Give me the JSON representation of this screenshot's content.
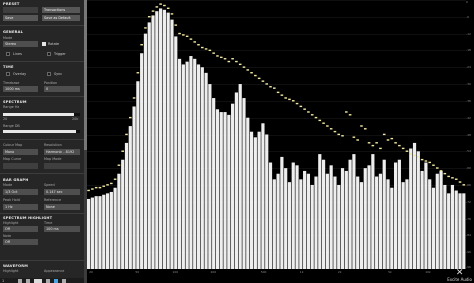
{
  "preset": {
    "header": "PRESET",
    "name": "",
    "transactions_button": "Transactions",
    "save_button": "Save",
    "save_default_button": "Save as Default"
  },
  "general": {
    "header": "GENERAL",
    "mode_label": "Mode",
    "mode_value": "Stereo",
    "rotate_label": "Rotate",
    "lines_label": "Lines",
    "trigger_label": "Trigger"
  },
  "time": {
    "header": "TIME",
    "overlay_label": "Overlay",
    "sync_label": "Sync",
    "timebase_label": "Timebase",
    "timebase_value": "1000 ms",
    "position_label": "Position",
    "position_value": "0"
  },
  "spectrum": {
    "header": "SPECTRUM",
    "range_hz_label": "Range Hz",
    "range_hz_left": "20",
    "range_hz_right": "20k",
    "range_db_label": "Range DB",
    "range_hz_fill": 0.92,
    "range_db_fill": 0.95
  },
  "colour": {
    "colour_map_label": "Colour Map",
    "colour_map_value": "Mono",
    "resolution_label": "Resolution",
    "resolution_value": "Harmonic - 8192",
    "map_curve_label": "Map Curve",
    "map_mode_label": "Map Mode"
  },
  "bar_graph": {
    "header": "BAR GRAPH",
    "mode_label": "Mode",
    "mode_value": "1/3 Oct",
    "speed_label": "Speed",
    "speed_value": "0.147 sec",
    "peak_hold_label": "Peak Hold",
    "peak_hold_value": "1 Hz",
    "reference_label": "Reference",
    "reference_value": "None"
  },
  "spectrum_highlight": {
    "header": "SPECTRUM HIGHLIGHT",
    "highlight_label": "Highlight",
    "highlight_value": "Off",
    "time_label": "Time",
    "time_value": "100 ms",
    "note_label": "Note",
    "note_value": "Off"
  },
  "waveform": {
    "header": "WAVEFORM",
    "highlight_label": "Highlight",
    "appearance_label": "Appearance"
  },
  "toolbar": {
    "page_value": "1"
  },
  "brand": {
    "mark": "✕",
    "name": "Excite Audio"
  },
  "y_axis_labels": [
    "0",
    "-6",
    "-12",
    "-18",
    "-24",
    "-30",
    "-36",
    "-42",
    "-48",
    "-54",
    "-60",
    "-66",
    "-72",
    "-78",
    "-84",
    "-90",
    "-96"
  ],
  "x_axis_labels": [
    "20",
    "50",
    "100",
    "200",
    "500",
    "1k",
    "2k",
    "5k",
    "10k"
  ],
  "colors": {
    "bar": "#eeeeee",
    "peak": "#f0e6a0",
    "background": "#000000",
    "panel": "#262626"
  },
  "chart_data": {
    "type": "bar",
    "xlabel": "",
    "ylabel": "",
    "ylim": [
      -96,
      0
    ],
    "grid": true,
    "values": [
      -71,
      -70.5,
      -70,
      -70,
      -69.5,
      -69,
      -68.5,
      -67,
      -62,
      -57,
      -51,
      -45,
      -38,
      -29,
      -19,
      -12,
      -8,
      -5.5,
      -4,
      -3,
      -3.5,
      -4.5,
      -7,
      -13,
      -21,
      -23,
      -22,
      -20,
      -21,
      -23,
      -24,
      -26,
      -30,
      -35,
      -39,
      -40,
      -40,
      -41,
      -37,
      -33,
      -30,
      -35,
      -42,
      -47,
      -49,
      -47,
      -44,
      -48,
      -58,
      -64,
      -62,
      -56,
      -60,
      -65,
      -58,
      -59,
      -64,
      -61,
      -62,
      -66,
      -63,
      -55,
      -57,
      -62,
      -59,
      -63,
      -66,
      -60,
      -61,
      -57,
      -55,
      -63,
      -65,
      -60,
      -59,
      -55,
      -63,
      -62,
      -57,
      -64,
      -67,
      -58,
      -57,
      -65,
      -64,
      -53,
      -51,
      -54,
      -61,
      -58,
      -64,
      -67,
      -62,
      -61,
      -66,
      -69,
      -66,
      -68,
      -69,
      -69
    ],
    "peaks": [
      -68,
      -67.5,
      -67,
      -67,
      -66.5,
      -66,
      -65.5,
      -64,
      -59,
      -54,
      -48,
      -42,
      -35,
      -26,
      -16,
      -10,
      -6,
      -4,
      -2.5,
      -1.5,
      -2,
      -3,
      -5,
      -9,
      -12,
      -12.5,
      -13,
      -14,
      -15,
      -16,
      -17,
      -17.5,
      -18,
      -19,
      -20,
      -20.5,
      -21,
      -22,
      -21,
      -22,
      -23,
      -24,
      -25,
      -26,
      -27,
      -28,
      -29,
      -30,
      -31,
      -31.5,
      -33,
      -34,
      -35,
      -35.5,
      -36,
      -37,
      -38,
      -39,
      -40,
      -41,
      -42,
      -43,
      -44,
      -45,
      -46,
      -47,
      -48,
      -48.5,
      -40,
      -41,
      -49,
      -50,
      -45,
      -46,
      -51,
      -52,
      -51,
      -53,
      -48,
      -50,
      -49.5,
      -51,
      -52,
      -53,
      -54,
      -55,
      -55.5,
      -56,
      -57,
      -57.5,
      -58,
      -59,
      -60,
      -61,
      -62,
      -63,
      -63.5,
      -64,
      -65,
      -66
    ]
  }
}
